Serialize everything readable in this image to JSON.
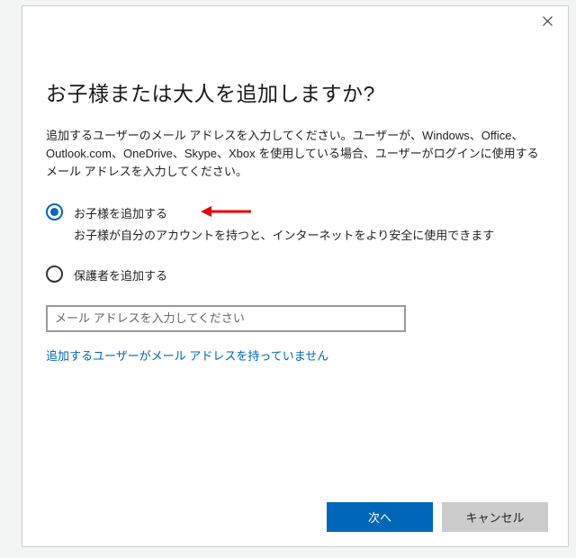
{
  "heading": "お子様または大人を追加しますか?",
  "description": "追加するユーザーのメール アドレスを入力してください。ユーザーが、Windows、Office、Outlook.com、OneDrive、Skype、Xbox を使用している場合、ユーザーがログインに使用するメール アドレスを入力してください。",
  "radios": {
    "child": {
      "label": "お子様を追加する",
      "sub": "お子様が自分のアカウントを持つと、インターネットをより安全に使用できます",
      "selected": true
    },
    "adult": {
      "label": "保護者を追加する",
      "selected": false
    }
  },
  "email": {
    "placeholder": "メール アドレスを入力してください",
    "value": ""
  },
  "link": "追加するユーザーがメール アドレスを持っていません",
  "buttons": {
    "next": "次へ",
    "cancel": "キャンセル"
  },
  "colors": {
    "accent": "#0067b8",
    "arrow": "#e40000"
  }
}
